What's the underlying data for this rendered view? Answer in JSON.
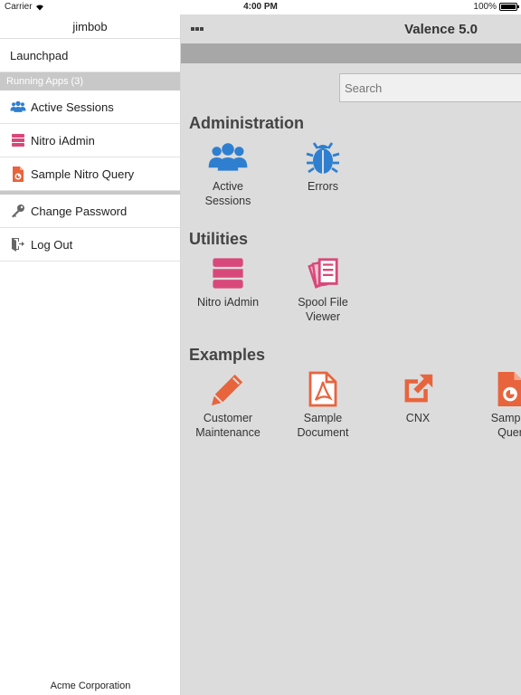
{
  "status": {
    "carrier": "Carrier",
    "time": "4:00 PM",
    "battery": "100%"
  },
  "sidebar": {
    "user": "jimbob",
    "launchpad": "Launchpad",
    "running_header": "Running Apps (3)",
    "apps": [
      {
        "label": "Active Sessions",
        "icon": "users-icon",
        "color": "#2e7fd0"
      },
      {
        "label": "Nitro iAdmin",
        "icon": "server-icon",
        "color": "#d9487a"
      },
      {
        "label": "Sample Nitro Query",
        "icon": "query-icon",
        "color": "#e8643c"
      }
    ],
    "actions": [
      {
        "label": "Change Password",
        "icon": "key-icon"
      },
      {
        "label": "Log Out",
        "icon": "logout-icon"
      }
    ],
    "footer": "Acme Corporation"
  },
  "main": {
    "title": "Valence 5.0",
    "search_placeholder": "Search",
    "sections": [
      {
        "title": "Administration",
        "tiles": [
          {
            "label_lines": [
              "Active",
              "Sessions"
            ],
            "icon": "users-icon",
            "color": "#2e7fd0"
          },
          {
            "label_lines": [
              "Errors"
            ],
            "icon": "bug-icon",
            "color": "#2e7fd0"
          }
        ]
      },
      {
        "title": "Utilities",
        "tiles": [
          {
            "label_lines": [
              "Nitro iAdmin"
            ],
            "icon": "server-icon",
            "color": "#d9487a"
          },
          {
            "label_lines": [
              "Spool File",
              "Viewer"
            ],
            "icon": "spool-icon",
            "color": "#d9487a"
          }
        ]
      },
      {
        "title": "Examples",
        "tiles": [
          {
            "label_lines": [
              "Customer",
              "Maintenance"
            ],
            "icon": "pencil-icon",
            "color": "#e8643c"
          },
          {
            "label_lines": [
              "Sample",
              "Document"
            ],
            "icon": "pdf-document-icon",
            "color": "#e8643c"
          },
          {
            "label_lines": [
              "CNX"
            ],
            "icon": "external-link-icon",
            "color": "#e8643c"
          },
          {
            "label_lines": [
              "Sample",
              "Quer"
            ],
            "icon": "query-icon",
            "color": "#e8643c"
          }
        ]
      }
    ]
  }
}
